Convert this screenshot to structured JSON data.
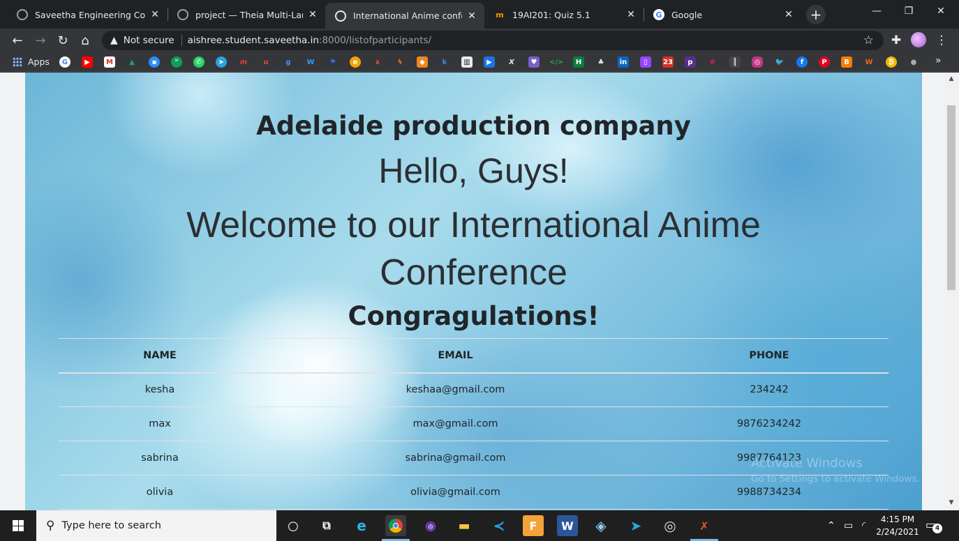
{
  "browser": {
    "tabs": [
      {
        "title": "Saveetha Engineering College",
        "active": false
      },
      {
        "title": "project — Theia Multi-Languag",
        "active": false
      },
      {
        "title": "International Anime conferenc",
        "active": true
      },
      {
        "title": "19AI201: Quiz 5.1",
        "active": false
      },
      {
        "title": "Google",
        "active": false
      }
    ],
    "new_tab_label": "+",
    "window_controls": {
      "minimize": "—",
      "maximize": "❐",
      "close": "✕"
    },
    "omnibox": {
      "security_label": "Not secure",
      "host": "aishree.student.saveetha.in",
      "path": ":8000/listofparticipants/"
    },
    "bookmarks_apps_label": "Apps"
  },
  "page": {
    "company": "Adelaide production company",
    "greeting": "Hello, Guys!",
    "welcome_line1": "Welcome to our International Anime",
    "welcome_line2": "Conference",
    "congrats": "Congragulations!",
    "table": {
      "headers": [
        "NAME",
        "EMAIL",
        "PHONE"
      ],
      "rows": [
        {
          "name": "kesha",
          "email": "keshaa@gmail.com",
          "phone": "234242"
        },
        {
          "name": "max",
          "email": "max@gmail.com",
          "phone": "9876234242"
        },
        {
          "name": "sabrina",
          "email": "sabrina@gmail.com",
          "phone": "9987764123"
        },
        {
          "name": "olivia",
          "email": "olivia@gmail.com",
          "phone": "9988734234"
        }
      ]
    },
    "watermark": {
      "line1": "Activate Windows",
      "line2": "Go to Settings to activate Windows."
    }
  },
  "taskbar": {
    "search_placeholder": "Type here to search",
    "time": "4:15 PM",
    "date": "2/24/2021",
    "notification_count": "4"
  },
  "colors": {
    "chrome_frame": "#202124",
    "chrome_toolbar": "#35363a",
    "text_dark": "#212529",
    "taskbar": "#1f1f1f"
  }
}
